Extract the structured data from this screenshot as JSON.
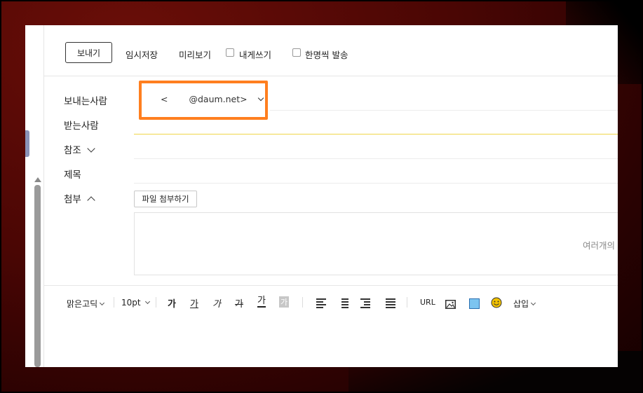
{
  "toolbar": {
    "send_label": "보내기",
    "draft_label": "임시저장",
    "preview_label": "미리보기",
    "to_me_label": "내게쓰기",
    "individual_label": "한명씩 발송"
  },
  "form": {
    "sender_label": "보내는사람",
    "sender_prefix": "<",
    "sender_value": "@daum.net>",
    "recipient_label": "받는사람",
    "cc_label": "참조",
    "subject_label": "제목",
    "attach_label": "첨부",
    "attach_button": "파일 첨부하기",
    "dropzone_text": "여러개의"
  },
  "editor": {
    "font_name": "맑은고딕",
    "font_size": "10pt",
    "bold": "가",
    "underline": "가",
    "italic": "가",
    "strike": "가",
    "text_color": "가",
    "bg_color": "가",
    "url_label": "URL",
    "insert_label": "삽입"
  },
  "colors": {
    "highlight": "#ff7f1f",
    "emoji": "#f2c200",
    "color_box": "#7cc4f0"
  }
}
